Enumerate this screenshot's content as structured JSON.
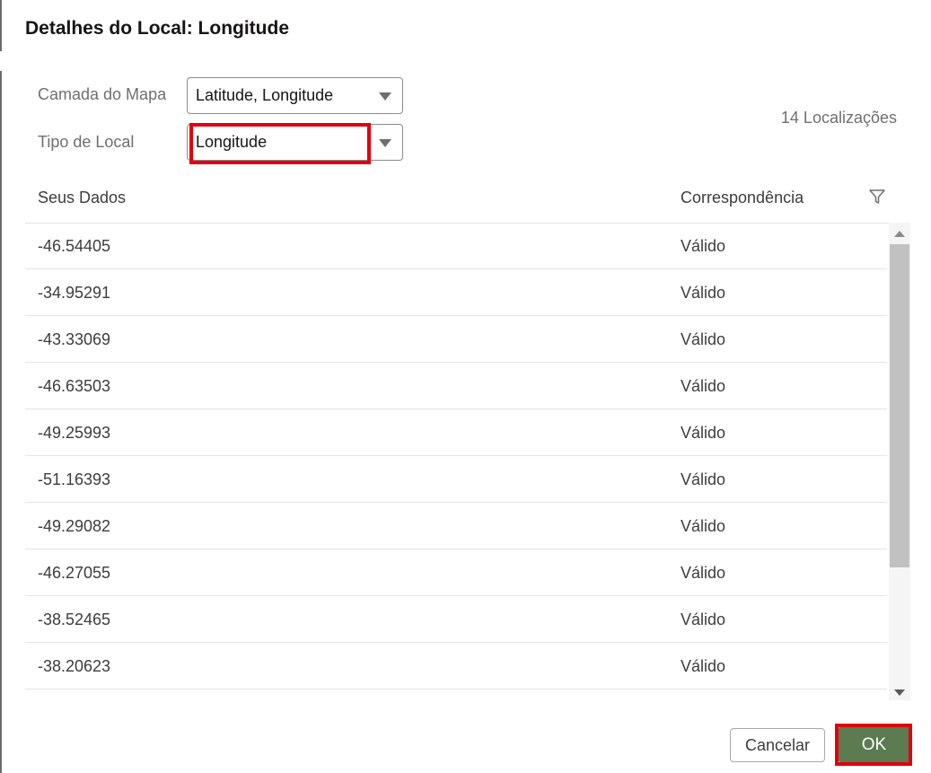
{
  "dialog": {
    "title": "Detalhes do Local: Longitude"
  },
  "fields": {
    "map_layer": {
      "label": "Camada do Mapa",
      "value": "Latitude, Longitude"
    },
    "location_type": {
      "label": "Tipo de Local",
      "value": "Longitude"
    }
  },
  "summary": {
    "count_text": "14 Localizações"
  },
  "table": {
    "columns": [
      "Seus Dados",
      "Correspondência"
    ],
    "rows": [
      {
        "data": "-46.54405",
        "match": "Válido"
      },
      {
        "data": "-34.95291",
        "match": "Válido"
      },
      {
        "data": "-43.33069",
        "match": "Válido"
      },
      {
        "data": "-46.63503",
        "match": "Válido"
      },
      {
        "data": "-49.25993",
        "match": "Válido"
      },
      {
        "data": "-51.16393",
        "match": "Válido"
      },
      {
        "data": "-49.29082",
        "match": "Válido"
      },
      {
        "data": "-46.27055",
        "match": "Válido"
      },
      {
        "data": "-38.52465",
        "match": "Válido"
      },
      {
        "data": "-38.20623",
        "match": "Válido"
      }
    ],
    "filter_icon": "filter-icon"
  },
  "buttons": {
    "cancel": "Cancelar",
    "ok": "OK"
  },
  "colors": {
    "primary_button": "#5c7b50",
    "highlight": "#e0000f"
  }
}
